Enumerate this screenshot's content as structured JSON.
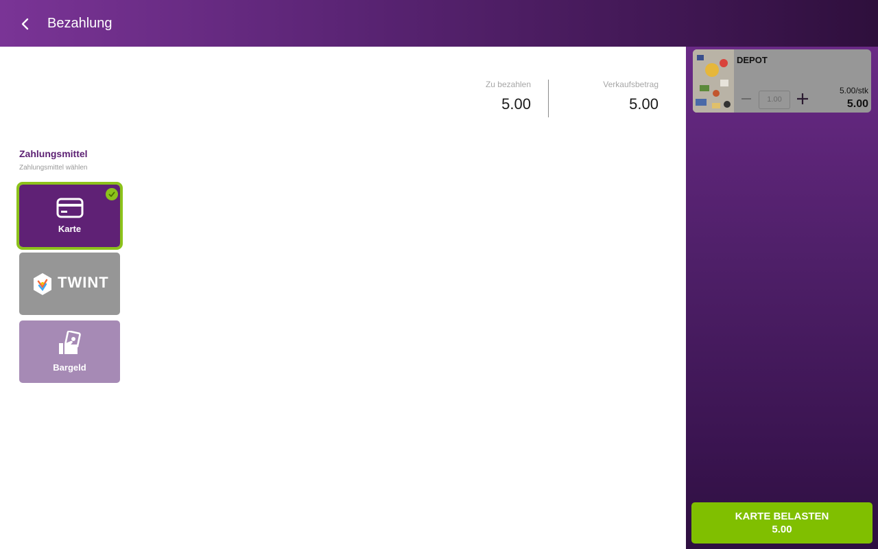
{
  "header": {
    "title": "Bezahlung",
    "back_icon": "chevron-left-icon"
  },
  "summary": {
    "to_pay_label": "Zu bezahlen",
    "to_pay_value": "5.00",
    "sale_amount_label": "Verkaufsbetrag",
    "sale_amount_value": "5.00"
  },
  "payment_methods": {
    "title": "Zahlungsmittel",
    "subtitle": "Zahlungsmittel wählen",
    "items": [
      {
        "label": "Karte",
        "icon": "credit-card-icon",
        "selected": true,
        "color": "#5f2175"
      },
      {
        "label": "TWINT",
        "icon": "twint-logo",
        "selected": false,
        "color": "#969696"
      },
      {
        "label": "Bargeld",
        "icon": "cash-icon",
        "selected": false,
        "color": "#a68ab5"
      }
    ]
  },
  "cart": {
    "items": [
      {
        "name": "DEPOT",
        "quantity": "1.00",
        "unit_price": "5.00/stk",
        "total": "5.00"
      }
    ]
  },
  "charge_button": {
    "line1": "KARTE BELASTEN",
    "line2": "5.00"
  },
  "colors": {
    "accent_green": "#80bf00",
    "brand_purple": "#5f2175"
  }
}
